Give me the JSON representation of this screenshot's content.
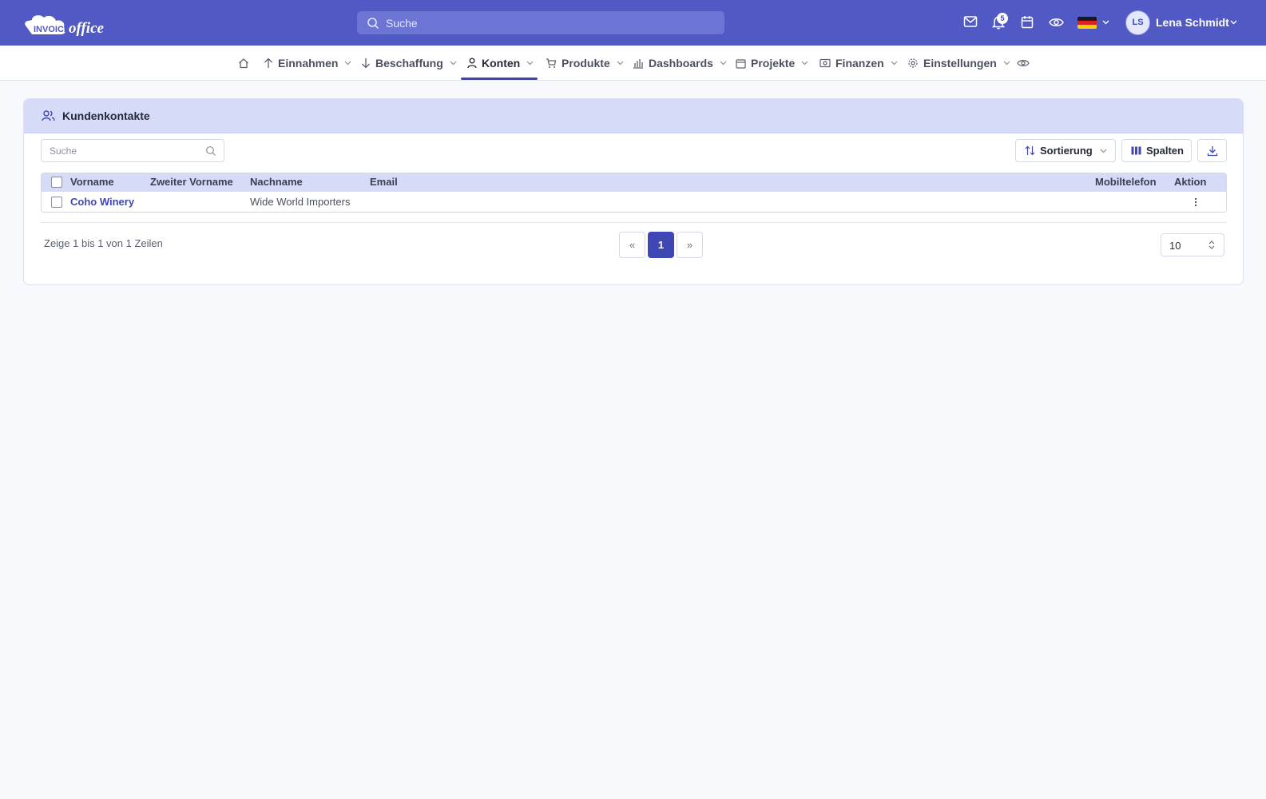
{
  "app": {
    "logo_text": "INVOICE office"
  },
  "topbar": {
    "search_placeholder": "Suche",
    "notification_count": "5",
    "user_initials": "LS",
    "user_name": "Lena Schmidt",
    "language": "de"
  },
  "nav": {
    "items": [
      {
        "label": "Einnahmen",
        "icon": "arrow-up-icon"
      },
      {
        "label": "Beschaffung",
        "icon": "arrow-down-icon"
      },
      {
        "label": "Konten",
        "icon": "user-icon",
        "active": true
      },
      {
        "label": "Produkte",
        "icon": "cart-icon"
      },
      {
        "label": "Dashboards",
        "icon": "bar-chart-icon"
      },
      {
        "label": "Projekte",
        "icon": "calendar-icon"
      },
      {
        "label": "Finanzen",
        "icon": "money-icon"
      },
      {
        "label": "Einstellungen",
        "icon": "gear-icon"
      }
    ]
  },
  "card": {
    "title": "Kundenkontakte",
    "search_placeholder": "Suche",
    "sort_label": "Sortierung",
    "columns_label": "Spalten"
  },
  "table": {
    "headers": {
      "first_name": "Vorname",
      "middle_name": "Zweiter Vorname",
      "last_name": "Nachname",
      "email": "Email",
      "mobile": "Mobiltelefon",
      "action": "Aktion"
    },
    "rows": [
      {
        "first_name": "Coho Winery",
        "middle_name": "",
        "last_name": "Wide World Importers",
        "email": "",
        "mobile": ""
      }
    ]
  },
  "pagination": {
    "info": "Zeige 1 bis 1 von 1 Zeilen",
    "prev": "«",
    "current": "1",
    "next": "»",
    "page_size": "10"
  },
  "colors": {
    "brand": "#5059c4",
    "accent": "#3f47b5",
    "header_bg": "#d6dbf7"
  }
}
